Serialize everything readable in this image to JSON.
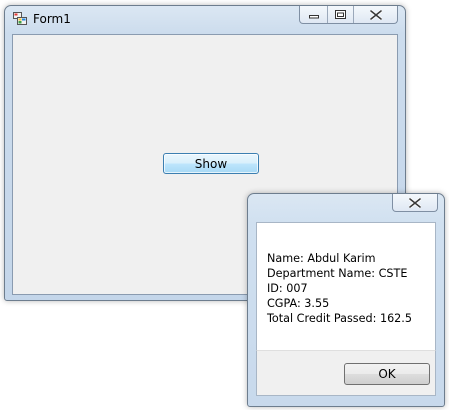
{
  "main_window": {
    "title": "Form1",
    "show_button_label": "Show"
  },
  "message_box": {
    "lines": [
      "Name: Abdul Karim",
      "Department Name: CSTE",
      "ID: 007",
      "CGPA: 3.55",
      "Total Credit Passed: 162.5"
    ],
    "ok_label": "OK"
  },
  "icons": {
    "app": "winforms-app-icon",
    "minimize": "minimize-icon",
    "maximize": "maximize-icon",
    "close": "close-icon"
  },
  "colors": {
    "frame": "#c4d6ea",
    "client": "#f0f0f0",
    "default_button_border": "#3c7fb1"
  }
}
